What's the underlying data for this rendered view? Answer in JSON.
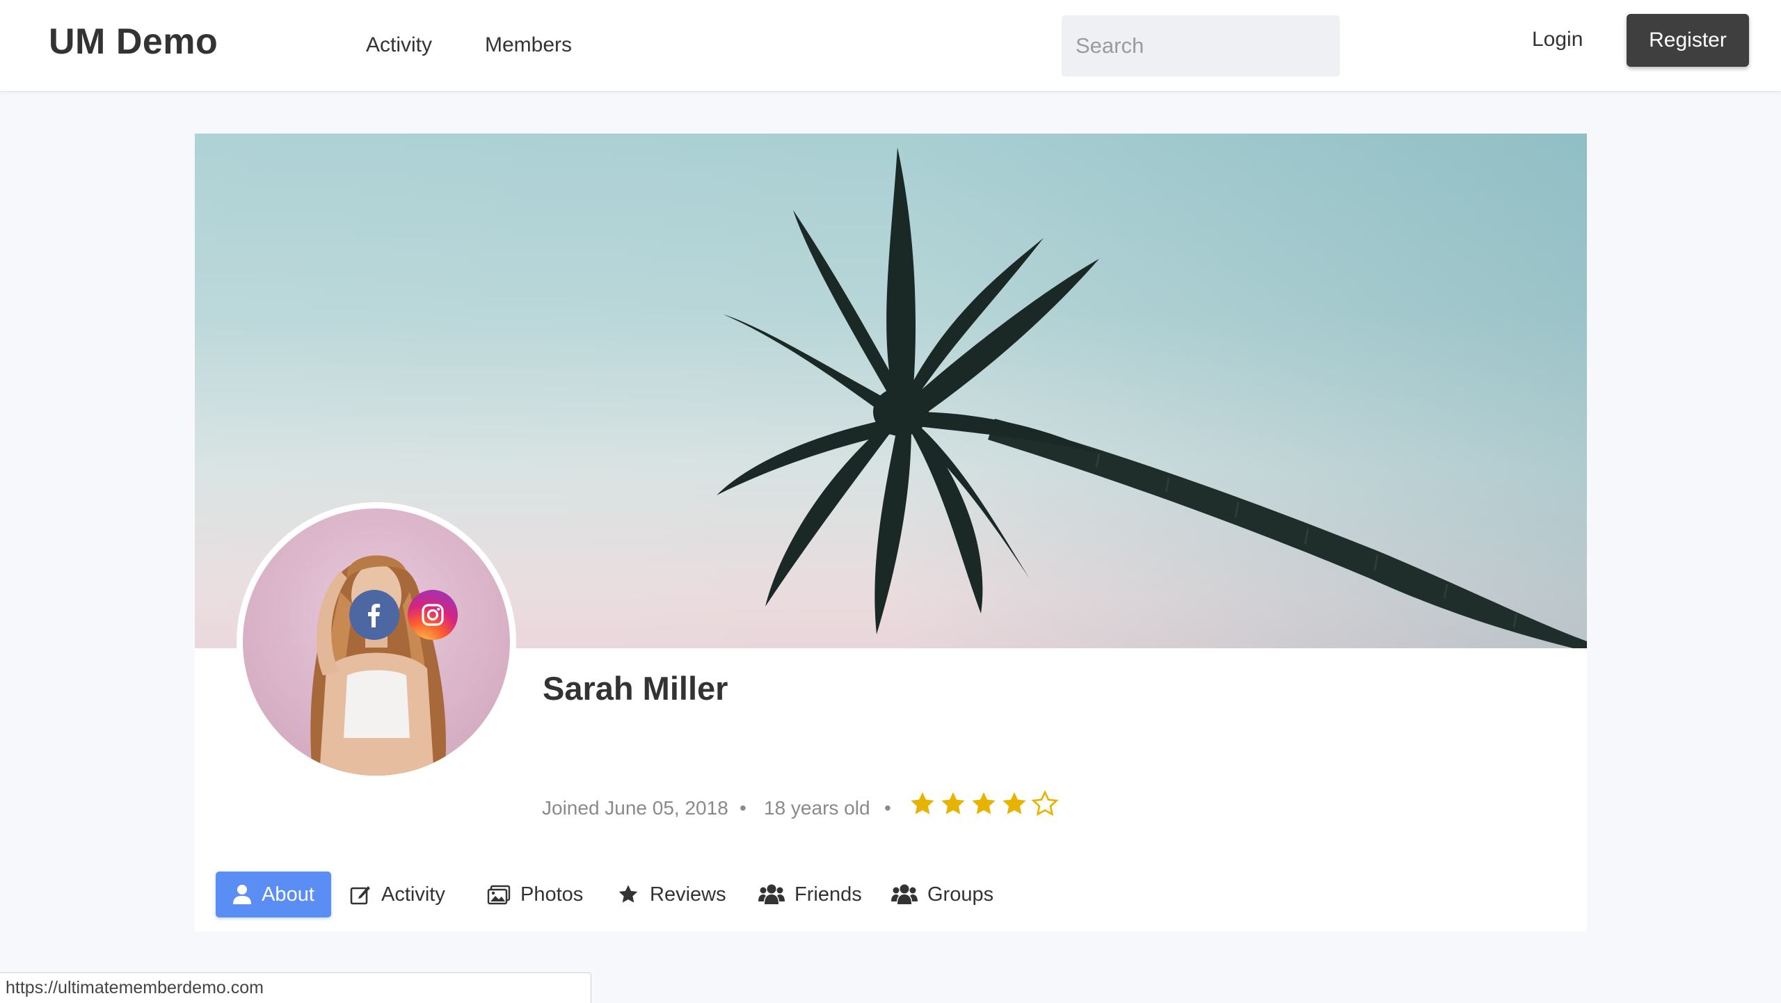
{
  "header": {
    "brand": "UM Demo",
    "nav": [
      {
        "label": "Activity"
      },
      {
        "label": "Members"
      }
    ],
    "search": {
      "placeholder": "Search",
      "value": ""
    },
    "login_label": "Login",
    "register_label": "Register"
  },
  "profile": {
    "name": "Sarah Miller",
    "social": [
      {
        "network": "facebook",
        "icon": "facebook-icon",
        "color": "#4c67a1"
      },
      {
        "network": "instagram",
        "icon": "instagram-icon"
      }
    ],
    "joined": "Joined June 05, 2018",
    "separator": "•",
    "age": "18 years old",
    "rating": {
      "value": 4,
      "max": 5,
      "color": "#e8b300"
    }
  },
  "tabs": [
    {
      "label": "About",
      "icon": "user-icon",
      "active": true
    },
    {
      "label": "Activity",
      "icon": "edit-icon"
    },
    {
      "label": "Photos",
      "icon": "photos-icon"
    },
    {
      "label": "Reviews",
      "icon": "star-icon"
    },
    {
      "label": "Friends",
      "icon": "users-icon"
    },
    {
      "label": "Groups",
      "icon": "users-icon"
    }
  ],
  "statusbar": {
    "url": "https://ultimatememberdemo.com"
  },
  "colors": {
    "accent": "#5b8ef5",
    "register_bg": "#3f3f3f"
  }
}
